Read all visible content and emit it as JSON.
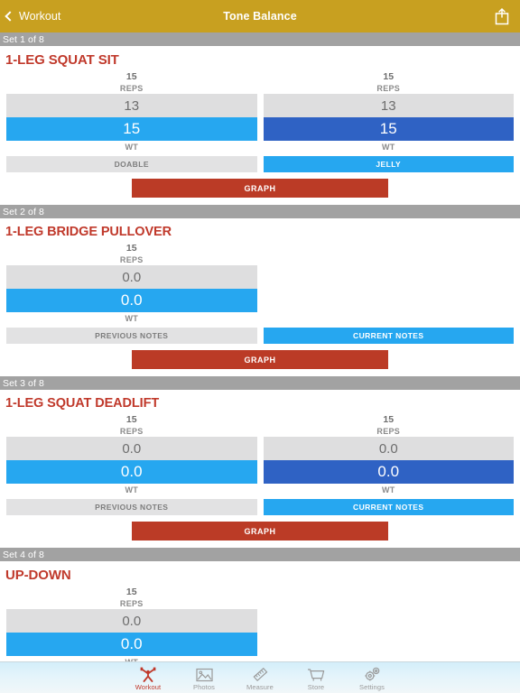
{
  "navbar": {
    "back_label": "Workout",
    "title": "Tone Balance",
    "share_icon": "share-icon",
    "back_icon": "chevron-left-icon",
    "bg_color": "#c8a020"
  },
  "colors": {
    "accent_red": "#c0392b",
    "graph_red": "#bb3b26",
    "current_blue": "#26a7f0",
    "alt_blue": "#2f62c4",
    "previous_gray": "#dededf",
    "set_header_gray": "#a2a2a2"
  },
  "sets": [
    {
      "header": "Set 1 of 8",
      "exercise": "1-LEG SQUAT SIT",
      "two_column": true,
      "left": {
        "reps_value": "15",
        "reps_label": "REPS",
        "previous_weight": "13",
        "current_weight": "15",
        "wt_label": "WT",
        "previous_notes": "DOABLE",
        "current_notes": ""
      },
      "right": {
        "reps_value": "15",
        "reps_label": "REPS",
        "previous_weight": "13",
        "current_weight": "15",
        "wt_label": "WT",
        "previous_notes": "",
        "current_notes": "JELLY"
      },
      "graph_label": "GRAPH"
    },
    {
      "header": "Set 2 of 8",
      "exercise": "1-LEG BRIDGE PULLOVER",
      "two_column": false,
      "left": {
        "reps_value": "15",
        "reps_label": "REPS",
        "previous_weight": "0.0",
        "current_weight": "0.0",
        "wt_label": "WT",
        "previous_notes": "PREVIOUS NOTES",
        "current_notes": "CURRENT NOTES"
      },
      "graph_label": "GRAPH"
    },
    {
      "header": "Set 3 of 8",
      "exercise": "1-LEG SQUAT DEADLIFT",
      "two_column": true,
      "left": {
        "reps_value": "15",
        "reps_label": "REPS",
        "previous_weight": "0.0",
        "current_weight": "0.0",
        "wt_label": "WT",
        "previous_notes": "PREVIOUS NOTES",
        "current_notes": ""
      },
      "right": {
        "reps_value": "15",
        "reps_label": "REPS",
        "previous_weight": "0.0",
        "current_weight": "0.0",
        "wt_label": "WT",
        "previous_notes": "",
        "current_notes": "CURRENT NOTES"
      },
      "graph_label": "GRAPH"
    },
    {
      "header": "Set 4 of 8",
      "exercise": "UP-DOWN",
      "two_column": false,
      "left": {
        "reps_value": "15",
        "reps_label": "REPS",
        "previous_weight": "0.0",
        "current_weight": "0.0",
        "wt_label": "WT"
      }
    }
  ],
  "tabbar": {
    "items": [
      {
        "label": "Workout",
        "icon": "weightlifter-icon",
        "active": true
      },
      {
        "label": "Photos",
        "icon": "photo-icon",
        "active": false
      },
      {
        "label": "Measure",
        "icon": "ruler-icon",
        "active": false
      },
      {
        "label": "Store",
        "icon": "cart-icon",
        "active": false
      },
      {
        "label": "Settings",
        "icon": "gears-icon",
        "active": false
      }
    ]
  }
}
